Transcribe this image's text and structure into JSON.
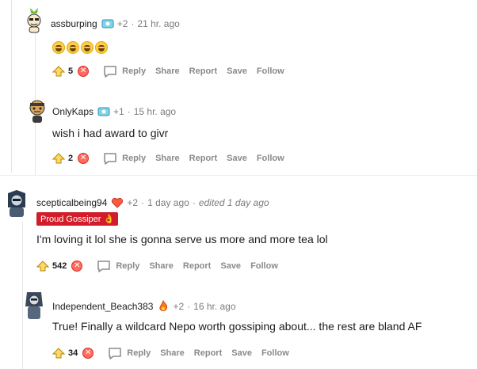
{
  "comments": [
    {
      "username": "assburping",
      "plus": "+2",
      "dot": "·",
      "time": "21 hr. ago",
      "emojis": [
        "laughing-emoji",
        "laughing-emoji",
        "laughing-emoji",
        "laughing-emoji"
      ],
      "score": "5"
    },
    {
      "username": "OnlyKaps",
      "plus": "+1",
      "dot": "·",
      "time": "15 hr. ago",
      "text": "wish i had award to givr",
      "score": "2"
    },
    {
      "username": "scepticalbeing94",
      "plus": "+2",
      "dot": "·",
      "time": "1 day ago",
      "dot2": "·",
      "edited": "edited 1 day ago",
      "flair": "Proud Gossiper",
      "text": "I'm loving it lol she is gonna serve us more and more tea lol",
      "score": "542"
    },
    {
      "username": "Independent_Beach383",
      "plus": "+2",
      "dot": "·",
      "time": "16 hr. ago",
      "text": "True! Finally a wildcard Nepo worth gossiping about... the rest are bland AF",
      "score": "34"
    }
  ],
  "actions": {
    "reply": "Reply",
    "share": "Share",
    "report": "Report",
    "save": "Save",
    "follow": "Follow"
  },
  "colors": {
    "flair_bg": "#d21c2a",
    "meta_gray": "#7c7c7c",
    "action_gray": "#878a8c",
    "downvote": "#ff6b5c"
  }
}
